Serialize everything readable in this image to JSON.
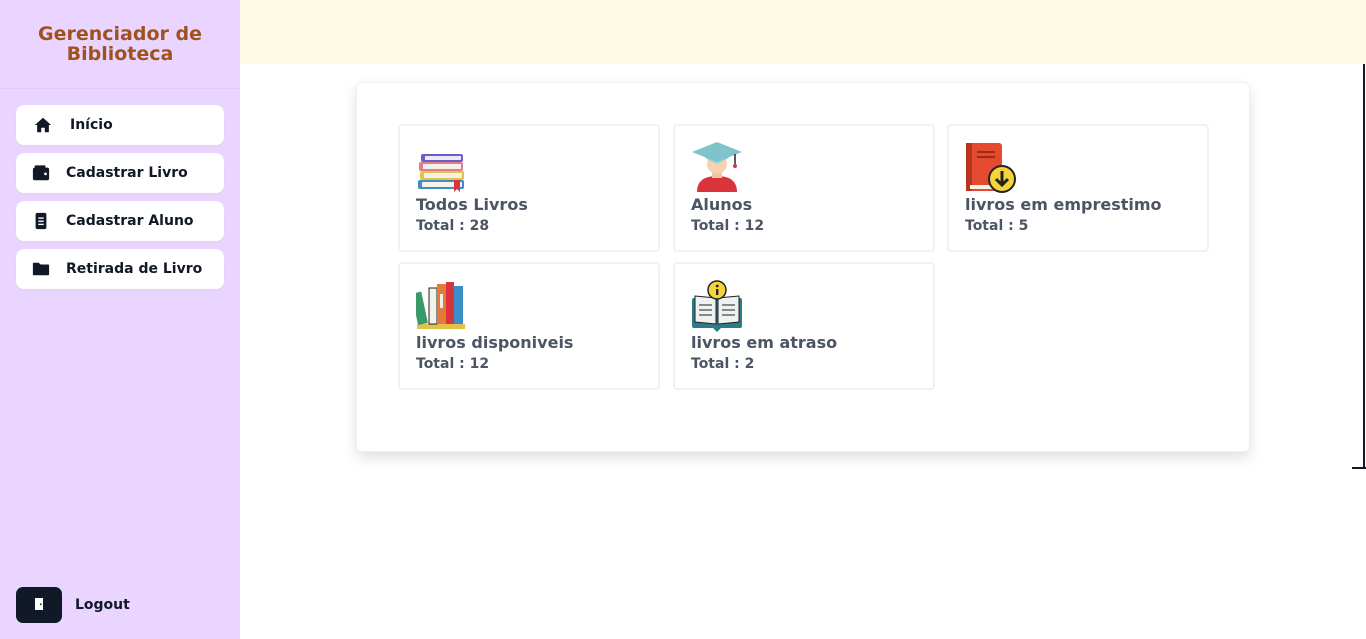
{
  "app": {
    "title": "Gerenciador de Biblioteca"
  },
  "sidebar": {
    "items": [
      {
        "label": "Início",
        "icon": "home-icon"
      },
      {
        "label": "Cadastrar Livro",
        "icon": "wallet-icon"
      },
      {
        "label": "Cadastrar Aluno",
        "icon": "document-icon"
      },
      {
        "label": "Retirada de Livro",
        "icon": "folder-icon"
      }
    ],
    "logout": {
      "label": "Logout",
      "icon": "door-icon"
    }
  },
  "dashboard": {
    "cards": [
      {
        "title": "Todos Livros",
        "total": "Total : 28",
        "icon": "books-stack-icon"
      },
      {
        "title": "Alunos",
        "total": "Total : 12",
        "icon": "graduate-student-icon"
      },
      {
        "title": "livros em emprestimo",
        "total": "Total : 5",
        "icon": "book-download-icon"
      },
      {
        "title": "livros disponiveis",
        "total": "Total : 12",
        "icon": "bookshelf-icon"
      },
      {
        "title": "livros em atraso",
        "total": "Total : 2",
        "icon": "open-book-info-icon"
      }
    ]
  },
  "colors": {
    "sidebar_bg": "#e9d5ff",
    "brand_text": "#a0521d",
    "topbar_bg": "#fefae6",
    "dark": "#111827",
    "card_text": "#4b5563"
  }
}
